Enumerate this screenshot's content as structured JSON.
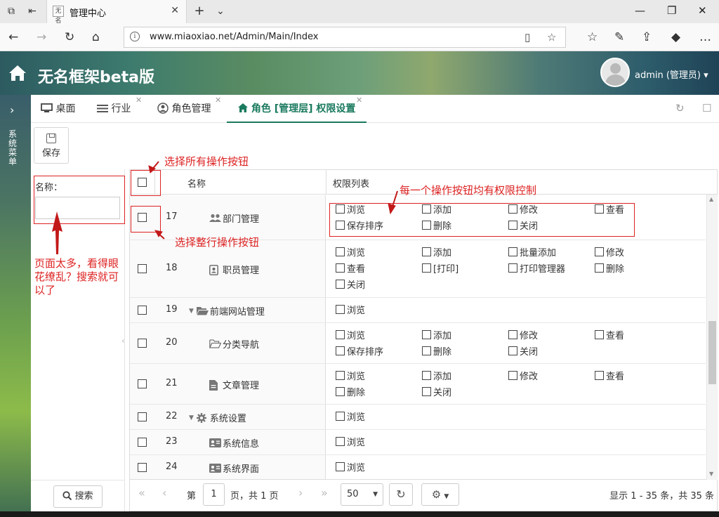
{
  "browser": {
    "tab_title": "管理中心",
    "favicon_text": "无名",
    "url": "www.miaoxiao.net/Admin/Main/Index"
  },
  "app": {
    "title": "无名框架beta版",
    "user": "admin (管理员) ▾"
  },
  "sidebar": {
    "label": "系统菜单"
  },
  "tabs": [
    {
      "label": "桌面",
      "icon": "monitor-icon"
    },
    {
      "label": "行业",
      "icon": "list-icon"
    },
    {
      "label": "角色管理",
      "icon": "user-circle-icon"
    },
    {
      "label": "角色 [管理层] 权限设置",
      "icon": "home-icon",
      "active": true
    }
  ],
  "toolbar": {
    "save_label": "保存"
  },
  "search": {
    "name_label": "名称：",
    "name_value": "",
    "button_label": "搜索"
  },
  "grid": {
    "col_name": "名称",
    "col_perms": "权限列表",
    "rows": [
      {
        "id": "17",
        "name": "部门管理",
        "icon": "users-icon",
        "expandable": false,
        "perms": [
          "浏览",
          "添加",
          "修改",
          "查看",
          "保存排序",
          "删除",
          "关闭"
        ]
      },
      {
        "id": "18",
        "name": "职员管理",
        "icon": "id-card-icon",
        "expandable": false,
        "perms": [
          "浏览",
          "添加",
          "批量添加",
          "修改",
          "查看",
          "[打印]",
          "打印管理器",
          "删除",
          "关闭"
        ]
      },
      {
        "id": "19",
        "name": "前端网站管理",
        "icon": "folder-open-icon",
        "expandable": true,
        "perms": [
          "浏览"
        ]
      },
      {
        "id": "20",
        "name": "分类导航",
        "icon": "folder-outline-icon",
        "expandable": false,
        "perms": [
          "浏览",
          "添加",
          "修改",
          "查看",
          "保存排序",
          "删除",
          "关闭"
        ]
      },
      {
        "id": "21",
        "name": "文章管理",
        "icon": "document-icon",
        "expandable": false,
        "perms": [
          "浏览",
          "添加",
          "修改",
          "查看",
          "删除",
          "关闭"
        ]
      },
      {
        "id": "22",
        "name": "系统设置",
        "icon": "gear-icon",
        "expandable": true,
        "perms": [
          "浏览"
        ]
      },
      {
        "id": "23",
        "name": "系统信息",
        "icon": "info-card-icon",
        "expandable": false,
        "perms": [
          "浏览"
        ]
      },
      {
        "id": "24",
        "name": "系统界面",
        "icon": "info-card-icon",
        "expandable": false,
        "perms": [
          "浏览"
        ]
      }
    ]
  },
  "pager": {
    "page_label": "第",
    "page_value": "1",
    "page_total": "页，共 1 页",
    "page_size": "50",
    "summary": "显示 1 - 35 条，共 35 条"
  },
  "annotations": {
    "select_all": "选择所有操作按钮",
    "select_row": "选择整行操作按钮",
    "each_button": "每一个操作按钮均有权限控制",
    "search_tip": "页面太多，看得眼花缭乱？搜索就可以了"
  },
  "colors": {
    "accent": "#1a7a5e",
    "annotation": "#dd2222"
  }
}
